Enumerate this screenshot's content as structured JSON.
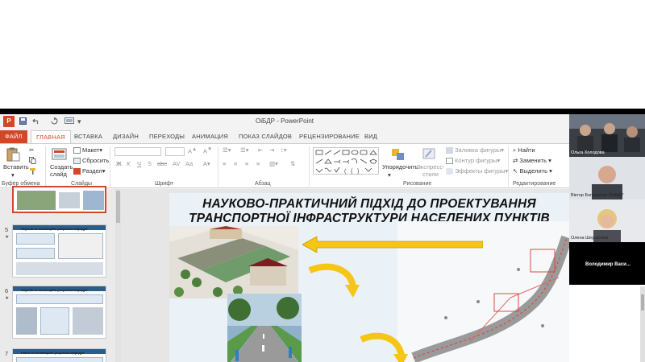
{
  "app": {
    "title": "ОіБДР - PowerPoint",
    "logo": "P",
    "colors": {
      "accent": "#d24726",
      "ribbon_bg": "#ffffff",
      "slide_bg": "#eaf1f7"
    }
  },
  "quick_access": [
    "save-icon",
    "undo-icon",
    "redo-icon",
    "start-slideshow-icon"
  ],
  "tabs": [
    {
      "label": "ФАЙЛ",
      "active": false
    },
    {
      "label": "ГЛАВНАЯ",
      "active": true
    },
    {
      "label": "ВСТАВКА",
      "active": false
    },
    {
      "label": "ДИЗАЙН",
      "active": false
    },
    {
      "label": "ПЕРЕХОДЫ",
      "active": false
    },
    {
      "label": "АНИМАЦИЯ",
      "active": false
    },
    {
      "label": "ПОКАЗ СЛАЙДОВ",
      "active": false
    },
    {
      "label": "РЕЦЕНЗИРОВАНИЕ",
      "active": false
    },
    {
      "label": "ВИД",
      "active": false
    }
  ],
  "ribbon": {
    "clipboard": {
      "label": "Буфер обмена",
      "paste": "Вставить"
    },
    "slides": {
      "label": "Слайды",
      "new_slide": "Создать слайд",
      "layout": "Макет",
      "reset": "Сбросить",
      "section": "Раздел"
    },
    "font": {
      "label": "Шрифт"
    },
    "paragraph": {
      "label": "Абзац"
    },
    "drawing": {
      "label": "Рисование",
      "arrange": "Упорядочить",
      "quick_styles": "Экспресс-стили",
      "fill": "Заливка фигуры",
      "outline": "Контур фигуры",
      "effects": "Эффекты фигуры"
    },
    "editing": {
      "label": "Редактирование",
      "find": "Найти",
      "replace": "Заменить",
      "select": "Выделить"
    }
  },
  "thumbnails": [
    {
      "num": "",
      "selected": true
    },
    {
      "num": "5",
      "title": "Наукові та інноваційні розробки кафедри"
    },
    {
      "num": "6",
      "title": "Наукові та інноваційні розробки кафедри"
    },
    {
      "num": "7",
      "title": "Ранги та інноваційні розробки кафедри"
    }
  ],
  "slide": {
    "title_line1": "НАУКОВО-ПРАКТИЧНИЙ ПІДХІД ДО ПРОЕКТУВАННЯ",
    "title_line2": "ТРАНСПОРТНОЇ ІНФРАСТРУКТУРИ НАСЕЛЕНИХ ПУНКТІВ"
  },
  "participants": [
    {
      "name": "Ольга Холодова"
    },
    {
      "name": "Віктор Богомолов ХНАДУ"
    },
    {
      "name": "Олена Шершенюк"
    },
    {
      "name": "Володимир Васи..."
    }
  ]
}
